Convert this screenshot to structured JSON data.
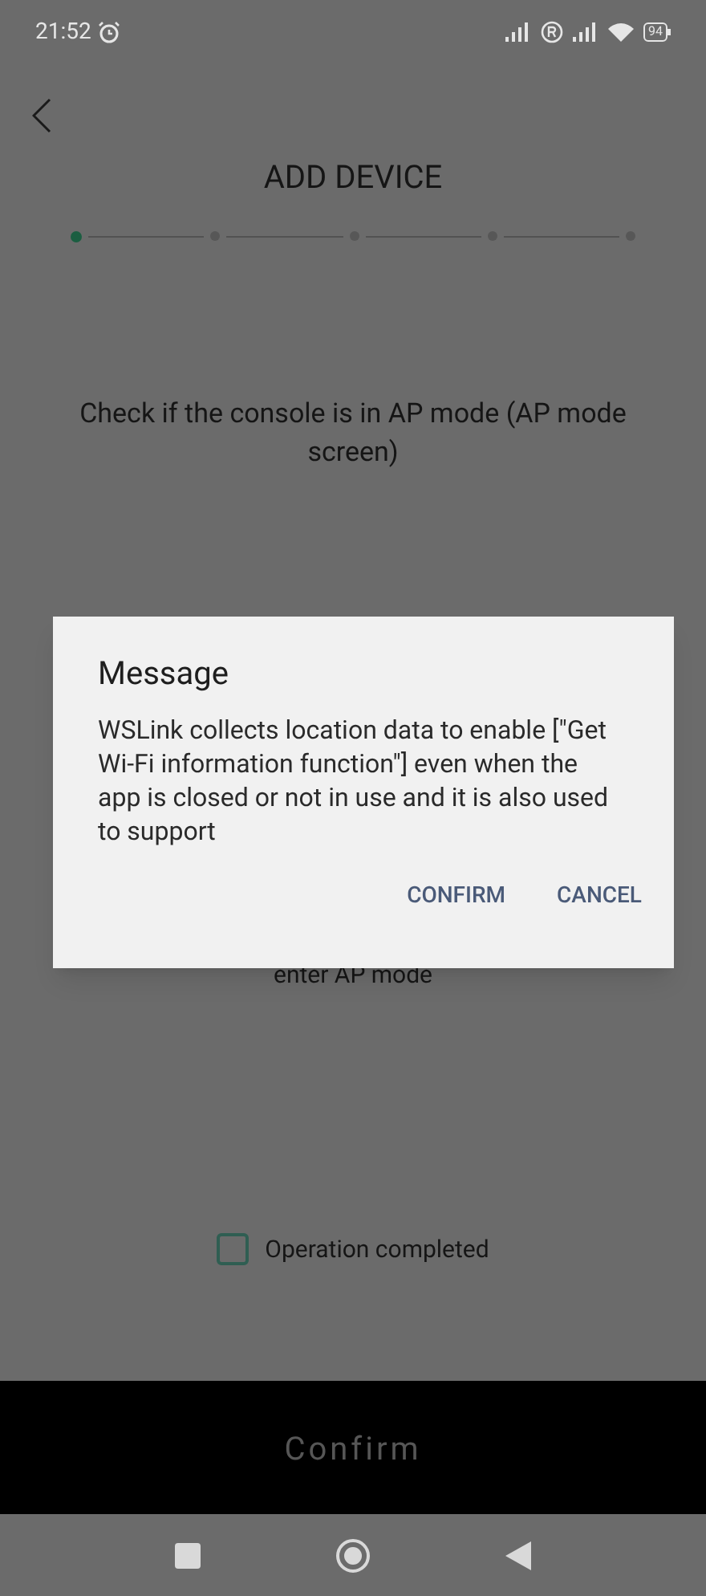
{
  "status_bar": {
    "time": "21:52",
    "battery": "94"
  },
  "header": {
    "title": "ADD DEVICE"
  },
  "steps": [
    {
      "selected": true
    },
    {
      "selected": false
    },
    {
      "selected": false
    },
    {
      "selected": false
    },
    {
      "selected": false
    }
  ],
  "instruction": "Check if the console is in AP mode (AP mode screen)",
  "partly_hidden_text": "enter AP mode",
  "checkbox": {
    "label": "Operation completed",
    "checked": false
  },
  "confirm_button": "Confirm",
  "dialog": {
    "title": "Message",
    "body": "WSLink collects location data to enable [\"Get Wi-Fi information function\"] even when the app is closed or not in use and it is also used to support",
    "buttons": [
      "CONFIRM",
      "CANCEL"
    ]
  }
}
